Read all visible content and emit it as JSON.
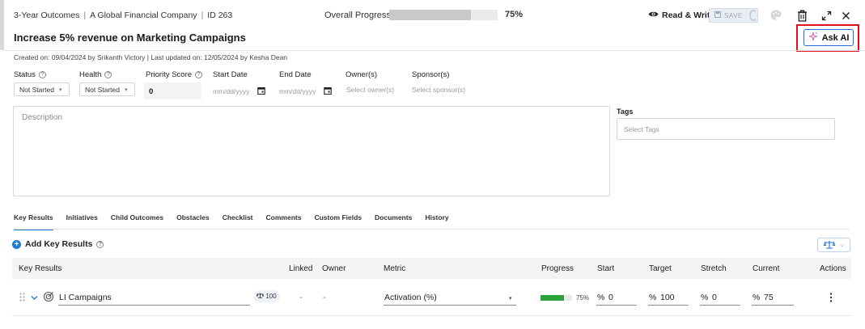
{
  "header": {
    "breadcrumb": [
      "3-Year Outcomes",
      "A Global Financial Company",
      "ID 263"
    ],
    "progress_label": "Overall Progress",
    "progress_value": 0.75,
    "progress_text": "75%",
    "access_mode": "Read & Write",
    "save_label": "SAVE",
    "title": "Increase 5% revenue on Marketing Campaigns",
    "ask_ai_label": "Ask AI"
  },
  "meta": {
    "text": "Created on: 09/04/2024 by Srikanth Victory  |  Last updated on: 12/05/2024 by Kesha Dean"
  },
  "fields": {
    "status_label": "Status",
    "status_value": "Not Started",
    "health_label": "Health",
    "health_value": "Not Started",
    "priority_label": "Priority Score",
    "priority_value": "0",
    "start_label": "Start Date",
    "start_placeholder": "mm/dd/yyyy",
    "end_label": "End Date",
    "end_placeholder": "mm/dd/yyyy",
    "owner_label": "Owner(s)",
    "owner_placeholder": "Select owner(s)",
    "sponsor_label": "Sponsor(s)",
    "sponsor_placeholder": "Select sponsor(s)",
    "description_placeholder": "Description",
    "tags_label": "Tags",
    "tags_placeholder": "Select Tags"
  },
  "tabs": [
    {
      "label": "Key Results",
      "active": true
    },
    {
      "label": "Initiatives"
    },
    {
      "label": "Child Outcomes"
    },
    {
      "label": "Obstacles"
    },
    {
      "label": "Checklist"
    },
    {
      "label": "Comments"
    },
    {
      "label": "Custom Fields"
    },
    {
      "label": "Documents"
    },
    {
      "label": "History"
    }
  ],
  "key_results": {
    "add_label": "Add Key Results",
    "columns": [
      "Key Results",
      "Linked",
      "Owner",
      "Metric",
      "Progress",
      "Start",
      "Target",
      "Stretch",
      "Current",
      "Actions"
    ],
    "rows": [
      {
        "name": "LI Campaigns",
        "weight": "100",
        "linked": "-",
        "owner": "-",
        "metric": "Activation (%)",
        "progress_value": 0.75,
        "progress_text": "75%",
        "start_unit": "%",
        "start": "0",
        "target_unit": "%",
        "target": "100",
        "stretch_unit": "%",
        "stretch": "0",
        "current_unit": "%",
        "current": "75"
      }
    ]
  },
  "colors": {
    "accent": "#1e7bd0",
    "highlight_box": "#e0101a",
    "progress_green": "#2aa33c"
  }
}
